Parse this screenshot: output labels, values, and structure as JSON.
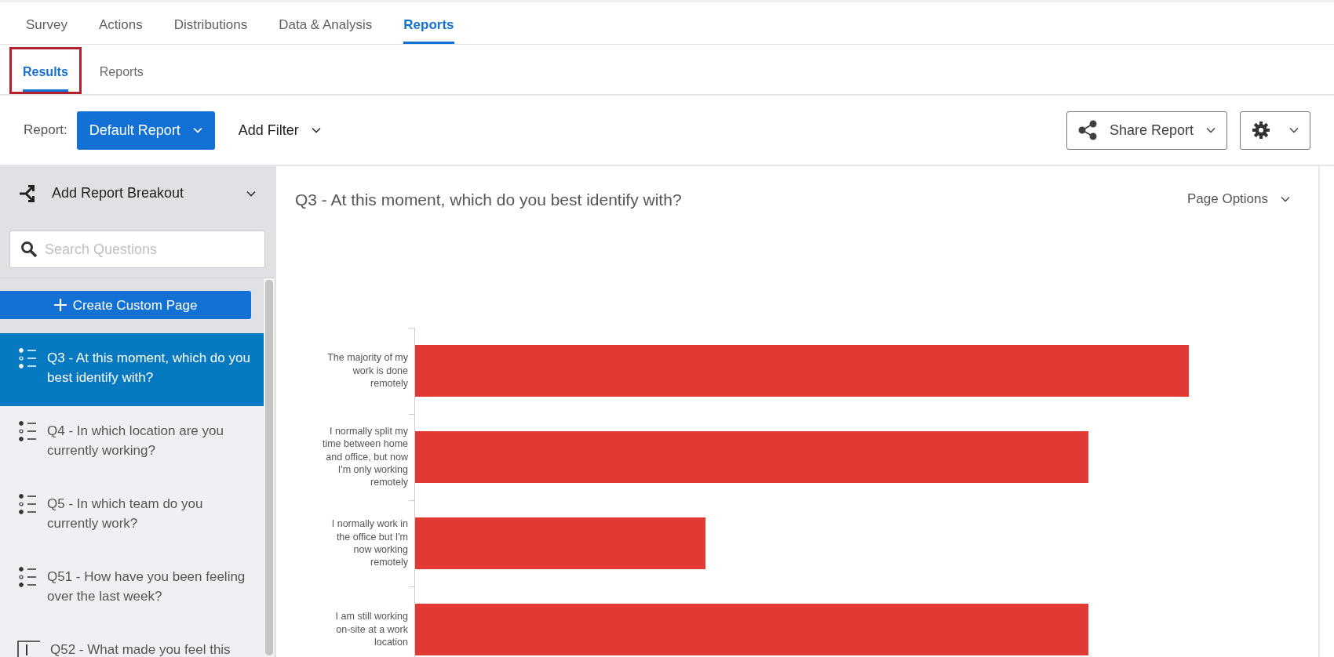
{
  "top_tabs": [
    {
      "label": "Survey",
      "selected": false
    },
    {
      "label": "Actions",
      "selected": false
    },
    {
      "label": "Distributions",
      "selected": false
    },
    {
      "label": "Data & Analysis",
      "selected": false
    },
    {
      "label": "Reports",
      "selected": true
    }
  ],
  "sub_tabs": [
    {
      "label": "Results",
      "selected": true,
      "highlighted": true
    },
    {
      "label": "Reports",
      "selected": false,
      "highlighted": false
    }
  ],
  "toolbar": {
    "report_label": "Report:",
    "report_button": "Default Report",
    "filter_button": "Add Filter",
    "share_button": "Share Report"
  },
  "sidebar": {
    "breakout": "Add Report Breakout",
    "search": {
      "placeholder": "Search Questions"
    },
    "create_button": "Create Custom Page",
    "items": [
      {
        "kind": "choice",
        "label": "Q3 - At this moment, which do you best identify with?",
        "selected": true
      },
      {
        "kind": "choice",
        "label": "Q4 - In which location are you currently working?",
        "selected": false
      },
      {
        "kind": "choice",
        "label": "Q5 - In which team do you currently work?",
        "selected": false
      },
      {
        "kind": "choice",
        "label": "Q51 - How have you been feeling over the last week?",
        "selected": false
      },
      {
        "kind": "text",
        "label": "Q52 - What made you feel this",
        "selected": false
      }
    ]
  },
  "main": {
    "title": "Q3 - At this moment, which do you best identify with?",
    "page_options": "Page Options",
    "chart": {
      "bars": [
        {
          "label": "The majority of my work is done remotely",
          "level": 0.88
        },
        {
          "label": "I normally split my time between home and office, but now I'm only working remotely",
          "level": 0.765
        },
        {
          "label": "I normally work in the office but I'm now working remotely",
          "level": 0.33
        },
        {
          "label": "I am still working on-site at a work location",
          "level": 0.765
        }
      ]
    }
  }
}
